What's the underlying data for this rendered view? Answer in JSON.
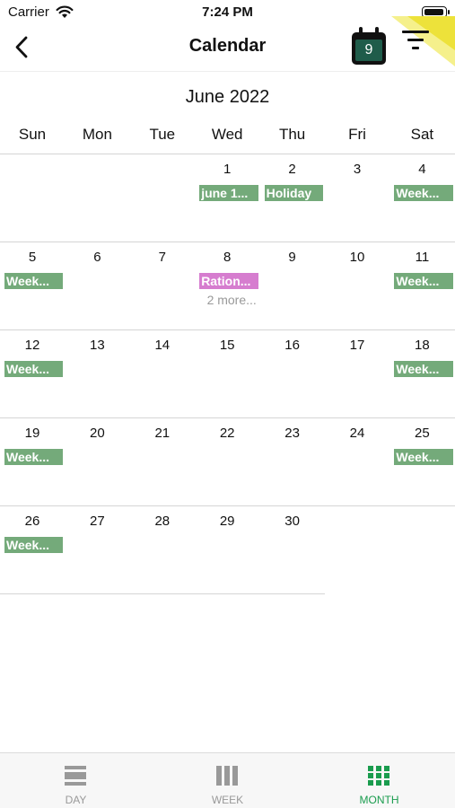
{
  "status_bar": {
    "carrier": "Carrier",
    "time": "7:24 PM"
  },
  "header": {
    "title": "Calendar",
    "today_day": "9"
  },
  "calendar": {
    "month_label": "June 2022",
    "weekdays": [
      "Sun",
      "Mon",
      "Tue",
      "Wed",
      "Thu",
      "Fri",
      "Sat"
    ],
    "weeks": [
      [
        "",
        "",
        "",
        "1",
        "2",
        "3",
        "4"
      ],
      [
        "5",
        "6",
        "7",
        "8",
        "9",
        "10",
        "11"
      ],
      [
        "12",
        "13",
        "14",
        "15",
        "16",
        "17",
        "18"
      ],
      [
        "19",
        "20",
        "21",
        "22",
        "23",
        "24",
        "25"
      ],
      [
        "26",
        "27",
        "28",
        "29",
        "30",
        "",
        ""
      ]
    ],
    "events": [
      {
        "date": "1",
        "label": "june 1...",
        "color": "#74aa7a"
      },
      {
        "date": "2",
        "label": "Holiday",
        "color": "#74aa7a"
      },
      {
        "date": "4",
        "label": "Week...",
        "color": "#74aa7a"
      },
      {
        "date": "5",
        "label": "Week...",
        "color": "#74aa7a"
      },
      {
        "date": "8",
        "label": "Ration...",
        "color": "#d67dcf"
      },
      {
        "date": "11",
        "label": "Week...",
        "color": "#74aa7a"
      },
      {
        "date": "12",
        "label": "Week...",
        "color": "#74aa7a"
      },
      {
        "date": "18",
        "label": "Week...",
        "color": "#74aa7a"
      },
      {
        "date": "19",
        "label": "Week...",
        "color": "#74aa7a"
      },
      {
        "date": "25",
        "label": "Week...",
        "color": "#74aa7a"
      },
      {
        "date": "26",
        "label": "Week...",
        "color": "#74aa7a"
      }
    ],
    "more": {
      "date": "8",
      "label": "2 more..."
    }
  },
  "tabs": [
    {
      "label": "DAY",
      "icon": "day-view-icon",
      "active": false
    },
    {
      "label": "WEEK",
      "icon": "week-view-icon",
      "active": false
    },
    {
      "label": "MONTH",
      "icon": "month-view-icon",
      "active": true
    }
  ],
  "colors": {
    "accent": "#1a9c4e",
    "event_green": "#74aa7a",
    "event_pink": "#d67dcf",
    "today_icon": "#1f5c4a",
    "inactive": "#999999"
  }
}
